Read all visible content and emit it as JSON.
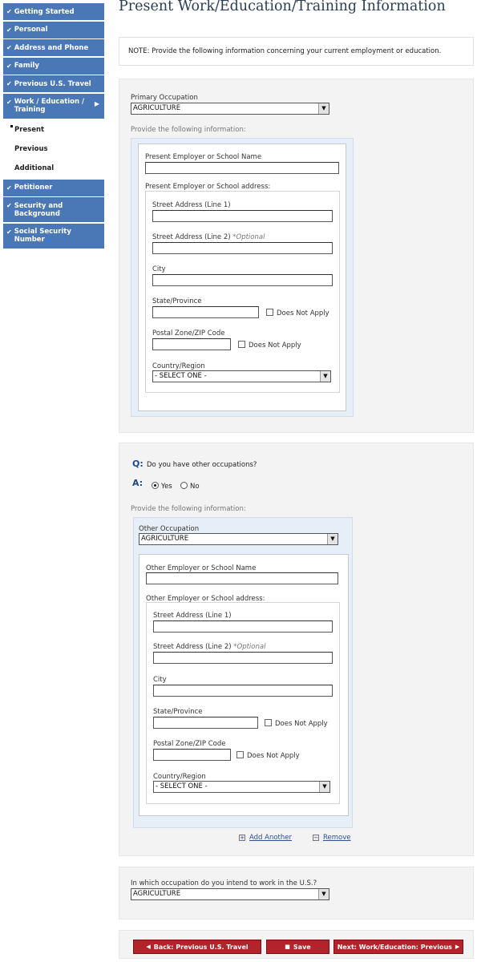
{
  "sidebar": {
    "items": [
      {
        "label": "Getting Started"
      },
      {
        "label": "Personal"
      },
      {
        "label": "Address and Phone"
      },
      {
        "label": "Family"
      },
      {
        "label": "Previous U.S. Travel"
      },
      {
        "label_line1": "Work / Education /",
        "label_line2": "Training"
      }
    ],
    "sub_items": [
      "Present",
      "Previous",
      "Additional"
    ],
    "items_after": [
      {
        "label": "Petitioner"
      },
      {
        "label_line1": "Security and",
        "label_line2": "Background"
      },
      {
        "label_line1": "Social Security",
        "label_line2": "Number"
      }
    ]
  },
  "page": {
    "title": "Present Work/Education/Training Information",
    "note": "NOTE: Provide the following information concerning your current employment or education."
  },
  "primary": {
    "occupation_label": "Primary Occupation",
    "occupation_value": "AGRICULTURE",
    "provide_info": "Provide the following information:",
    "employer_label": "Present Employer or School Name",
    "address_label": "Present Employer or School address:",
    "street1_label": "Street Address (Line 1)",
    "street2_label": "Street Address (Line 2)",
    "optional": "*Optional",
    "city_label": "City",
    "state_label": "State/Province",
    "postal_label": "Postal Zone/ZIP Code",
    "does_not_apply": "Does Not Apply",
    "country_label": "Country/Region",
    "country_value": "- SELECT ONE -"
  },
  "other": {
    "q_marker": "Q:",
    "question": "Do you have other occupations?",
    "a_marker": "A:",
    "yes_label": "Yes",
    "no_label": "No",
    "provide_info": "Provide the following information:",
    "occupation_label": "Other Occupation",
    "occupation_value": "AGRICULTURE",
    "employer_label": "Other Employer or School Name",
    "address_label": "Other Employer or School address:",
    "street1_label": "Street Address (Line 1)",
    "street2_label": "Street Address (Line 2)",
    "optional": "*Optional",
    "city_label": "City",
    "state_label": "State/Province",
    "postal_label": "Postal Zone/ZIP Code",
    "does_not_apply": "Does Not Apply",
    "country_label": "Country/Region",
    "country_value": "- SELECT ONE -",
    "add_another": "Add Another",
    "remove": "Remove"
  },
  "intent": {
    "label": "In which occupation do you intend to work in the U.S.?",
    "value": "AGRICULTURE"
  },
  "buttons": {
    "back": "Back: Previous U.S. Travel",
    "save": "Save",
    "next": "Next: Work/Education: Previous"
  }
}
